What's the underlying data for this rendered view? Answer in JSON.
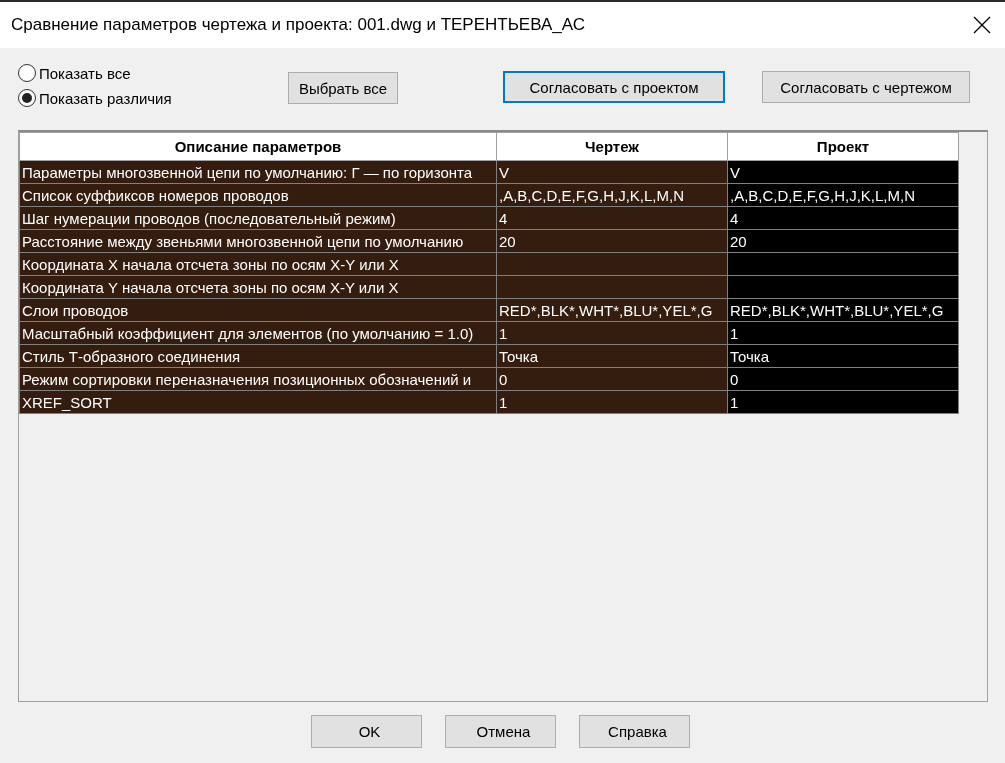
{
  "window": {
    "title": "Сравнение параметров чертежа и проекта: 001.dwg и ТЕРЕНТЬЕВА_АС"
  },
  "view_options": [
    {
      "label": "Показать все",
      "selected": false
    },
    {
      "label": "Показать различия",
      "selected": true
    }
  ],
  "top_buttons": [
    {
      "label": "Выбрать все",
      "focused": false
    },
    {
      "label": "Согласовать с проектом",
      "focused": true
    },
    {
      "label": "Согласовать с чертежом",
      "focused": false
    }
  ],
  "table": {
    "columns": [
      "Описание параметров",
      "Чертеж",
      "Проект"
    ],
    "rows": [
      [
        "Параметры многозвенной цепи по умолчанию: Г — по горизонта",
        "V",
        "V"
      ],
      [
        "Список суффиксов номеров проводов",
        ",A,B,C,D,E,F,G,H,J,K,L,M,N",
        ",A,B,C,D,E,F,G,H,J,K,L,M,N"
      ],
      [
        "Шаг нумерации проводов (последовательный режим)",
        "4",
        "4"
      ],
      [
        "Расстояние между звеньями многозвенной цепи по умолчанию",
        "20",
        "20"
      ],
      [
        "Координата X начала отсчета зоны по осям X-Y или X",
        "",
        ""
      ],
      [
        "Координата Y начала отсчета зоны по осям X-Y или X",
        "",
        ""
      ],
      [
        "Слои проводов",
        "RED*,BLK*,WHT*,BLU*,YEL*,G",
        "RED*,BLK*,WHT*,BLU*,YEL*,G"
      ],
      [
        "Масштабный коэффициент для элементов (по умолчанию = 1.0)",
        "1",
        "1"
      ],
      [
        "Стиль Т-образного соединения",
        "Точка",
        "Точка"
      ],
      [
        "Режим сортировки переназначения позиционных обозначений и",
        "0",
        "0"
      ],
      [
        "XREF_SORT",
        "1",
        "1"
      ]
    ]
  },
  "bottom_buttons": [
    "OK",
    "Отмена",
    "Справка"
  ]
}
